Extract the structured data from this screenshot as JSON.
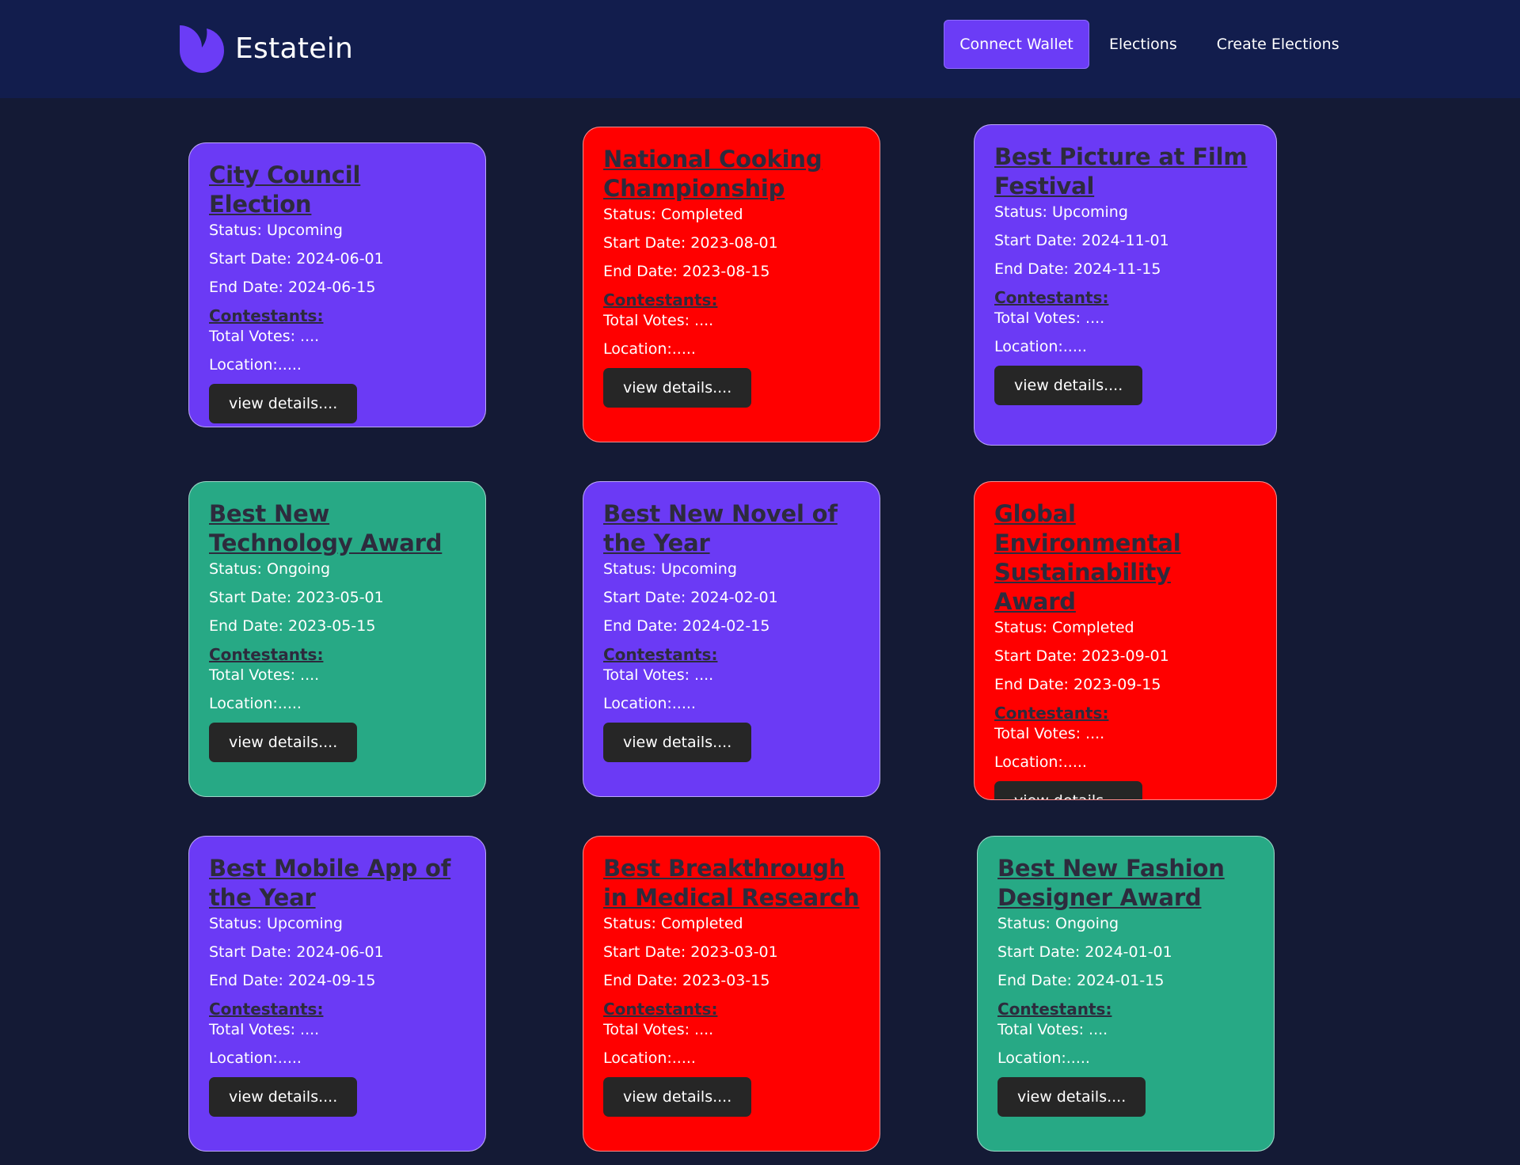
{
  "header": {
    "brand_name": "Estatein",
    "nav": {
      "connect_wallet": "Connect Wallet",
      "elections": "Elections",
      "create_elections": "Create Elections"
    }
  },
  "colors": {
    "header_bg": "#121d4d",
    "page_bg": "#141a35",
    "accent": "#6b3cf6",
    "upcoming": "#6b3af5",
    "completed": "#ff0000",
    "ongoing": "#27a985",
    "button_dark": "#262626"
  },
  "labels": {
    "contestants": "Contestants:",
    "view_details": "view details...."
  },
  "cards": [
    {
      "title": "City Council Election",
      "status": "Status: Upcoming",
      "start": "Start Date: 2024-06-01",
      "end": "End Date: 2024-06-15",
      "votes": "Total Votes: ....",
      "location": "Location:....."
    },
    {
      "title": "National Cooking Championship",
      "status": "Status: Completed",
      "start": "Start Date: 2023-08-01",
      "end": "End Date: 2023-08-15",
      "votes": "Total Votes: ....",
      "location": "Location:....."
    },
    {
      "title": "Best Picture at Film Festival",
      "status": "Status: Upcoming",
      "start": "Start Date: 2024-11-01",
      "end": "End Date: 2024-11-15",
      "votes": "Total Votes: ....",
      "location": "Location:....."
    },
    {
      "title": "Best New Technology Award",
      "status": "Status: Ongoing",
      "start": "Start Date: 2023-05-01",
      "end": "End Date: 2023-05-15",
      "votes": "Total Votes: ....",
      "location": "Location:....."
    },
    {
      "title": "Best New Novel of the Year",
      "status": "Status: Upcoming",
      "start": "Start Date: 2024-02-01",
      "end": "End Date: 2024-02-15",
      "votes": "Total Votes: ....",
      "location": "Location:....."
    },
    {
      "title": "Global Environmental Sustainability Award",
      "status": "Status: Completed",
      "start": "Start Date: 2023-09-01",
      "end": "End Date: 2023-09-15",
      "votes": "Total Votes: ....",
      "location": "Location:....."
    },
    {
      "title": "Best Mobile App of the Year",
      "status": "Status: Upcoming",
      "start": "Start Date: 2024-06-01",
      "end": "End Date: 2024-09-15",
      "votes": "Total Votes: ....",
      "location": "Location:....."
    },
    {
      "title": "Best Breakthrough in Medical Research",
      "status": "Status: Completed",
      "start": "Start Date: 2023-03-01",
      "end": "End Date: 2023-03-15",
      "votes": "Total Votes: ....",
      "location": "Location:....."
    },
    {
      "title": "Best New Fashion Designer Award",
      "status": "Status: Ongoing",
      "start": "Start Date: 2024-01-01",
      "end": "End Date: 2024-01-15",
      "votes": "Total Votes: ....",
      "location": "Location:....."
    }
  ]
}
